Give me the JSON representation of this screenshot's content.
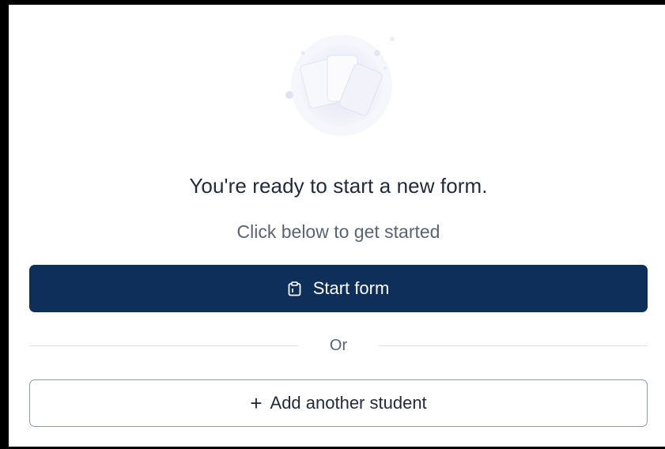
{
  "empty_state": {
    "headline": "You're ready to start a new form.",
    "subtext": "Click below to get started"
  },
  "actions": {
    "start_form_label": "Start form",
    "start_form_icon": "clipboard-icon",
    "divider_label": "Or",
    "add_student_label": "Add another student",
    "add_student_icon": "plus-icon",
    "plus_glyph": "+"
  },
  "colors": {
    "primary": "#0d2f5a",
    "text": "#1f2a3d",
    "muted_text": "#5a6475",
    "illustration_tint": "#e7eaf6"
  }
}
